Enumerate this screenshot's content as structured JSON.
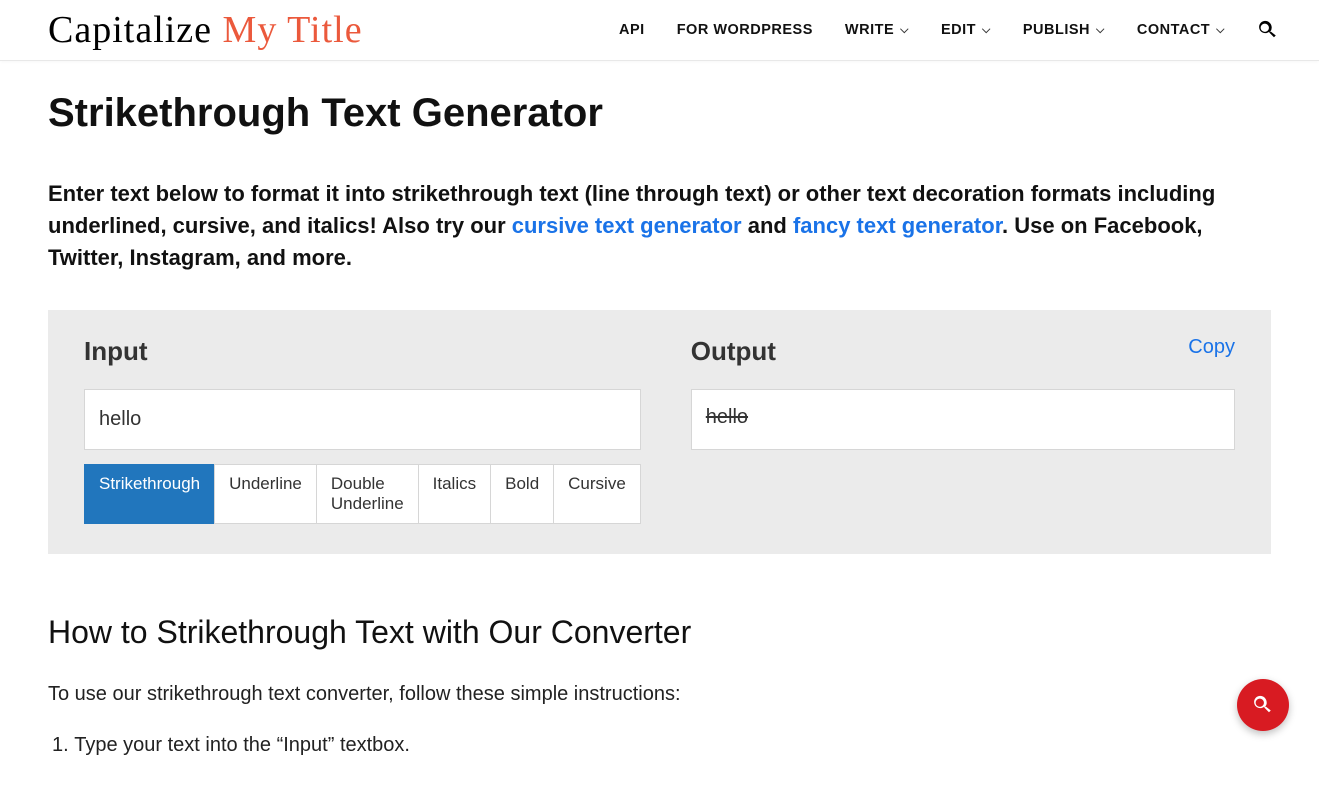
{
  "logo": {
    "part1": "Capitalize ",
    "part2": "My Title"
  },
  "nav": {
    "items": [
      "API",
      "FOR WORDPRESS",
      "WRITE",
      "EDIT",
      "PUBLISH",
      "CONTACT"
    ],
    "dropdown": [
      false,
      false,
      true,
      true,
      true,
      true
    ]
  },
  "page": {
    "h1": "Strikethrough Text Generator",
    "intro_pre": "Enter text below to format it into strikethrough text (line through text) or other text decoration formats including underlined, cursive, and italics! Also try our ",
    "intro_link1": "cursive text generator",
    "intro_mid": " and ",
    "intro_link2": "fancy text generator",
    "intro_post": ". Use on Facebook, Twitter, Instagram, and more."
  },
  "generator": {
    "input_label": "Input",
    "output_label": "Output",
    "input_value": "hello",
    "output_value": "hello",
    "copy_label": "Copy",
    "tabs": [
      "Strikethrough",
      "Underline",
      "Double Underline",
      "Italics",
      "Bold",
      "Cursive"
    ],
    "active_tab": 0
  },
  "howto": {
    "heading": "How to Strikethrough Text with Our Converter",
    "body": "To use our strikethrough text converter, follow these simple instructions:",
    "step1": "Type your text into the “Input” textbox."
  }
}
